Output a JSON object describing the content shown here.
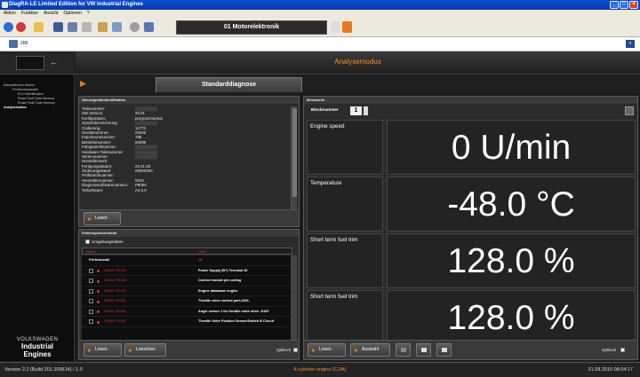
{
  "window": {
    "title": "DiagRA-LE Limited Edition for VW Industrial Engines"
  },
  "menu": [
    "Aktion",
    "Funktion",
    "Ansicht",
    "Optionen",
    "?"
  ],
  "toolbar": {
    "ecu_label": "01  Motorelektronik"
  },
  "toolbar2": {
    "count": "200"
  },
  "sidebar": {
    "tree": [
      {
        "label": "Automatischer Modus",
        "level": 1
      },
      {
        "label": "Funktionsauswahl",
        "level": 2
      },
      {
        "label": "ECU Identification",
        "level": 3
      },
      {
        "label": "Read Fault Code Memory",
        "level": 3
      },
      {
        "label": "Erase Fault Code Memory",
        "level": 3
      },
      {
        "label": "Analysemodus",
        "level": 1,
        "active": true
      }
    ],
    "brand_line1": "VOLKSWAGEN",
    "brand_line2": "Industrial",
    "brand_line3": "Engines"
  },
  "header": {
    "mode": "Analysemodus",
    "tab": "Standarddiagnose"
  },
  "ident": {
    "title": "Steuergeräteidentifikation",
    "rows": [
      {
        "key": "Teilenummer:",
        "value": "",
        "blur": true
      },
      {
        "key": "SW-Version:",
        "value": "XC21"
      },
      {
        "key": "Konfiguration:",
        "value": "programmierbar"
      },
      {
        "key": "Systembezeichnung:",
        "value": "",
        "blur": true
      },
      {
        "key": "Codierung:",
        "value": "11773"
      },
      {
        "key": "Gerätenummer:",
        "value": "00200"
      },
      {
        "key": "Importeursnummer:",
        "value": "786"
      },
      {
        "key": "Betriebsnummer:",
        "value": "00099"
      },
      {
        "key": "Fahrgestellnummer:",
        "value": "",
        "blur": true
      },
      {
        "key": "Hardware-Teilenummer:",
        "value": "",
        "blur": true
      },
      {
        "key": "Seriennummer:",
        "value": "",
        "blur": true
      },
      {
        "key": "Herstellerwerk:",
        "value": ""
      },
      {
        "key": "Fertigungsdatum:",
        "value": "23.01.03"
      },
      {
        "key": "Änderungsstand:",
        "value": "00000000"
      },
      {
        "key": "Prüfstandnummer:",
        "value": ""
      },
      {
        "key": "Herstellernummer:",
        "value": "0010"
      },
      {
        "key": "Diagnosesoftwarenummer:",
        "value": "P9000"
      },
      {
        "key": "Teilsoftware:",
        "value": "A4.6.5"
      }
    ],
    "read_button": "Lesen"
  },
  "faults": {
    "title": "Fehlerspeicherinhalt",
    "env_checkbox": "Umgebungsdaten",
    "col_name": "Name",
    "col_text": "Wert",
    "group": {
      "label": "Fehleranzahl",
      "value": "15"
    },
    "rows": [
      {
        "code": "16518 / P0134",
        "text": "Power Supply (B+) Terminal 30"
      },
      {
        "code": "16522 / P0138",
        "text": "Control module pin coding"
      },
      {
        "code": "16516 / P0132",
        "text": "Engine database/ engine"
      },
      {
        "code": "17662 / P1254",
        "text": "Throttle valve control part-2320-"
      },
      {
        "code": "17661 / P1253",
        "text": "Angle sensor 1 for throttle valve drive -G187"
      },
      {
        "code": "17659 / P1251",
        "text": "Throttle Valve Position Sensor/Switch B  Circuit"
      }
    ],
    "read_button": "Lesen",
    "clear_button": "Loeschen",
    "cyclic_label": "Zyklisch"
  },
  "meas": {
    "title": "Messwerte",
    "block_label": "Blocknummer",
    "block_value": "1",
    "rows": [
      {
        "label": "Engine speed",
        "value": "0 U/min"
      },
      {
        "label": "Temperature",
        "value": "-48.0 °C"
      },
      {
        "label": "Short term fuel trim",
        "value": "128.0 %"
      },
      {
        "label": "Short term fuel trim",
        "value": "128.0 %"
      }
    ],
    "read_button": "Lesen",
    "select_button": "Auswahl",
    "cyclic_label": "Zyklisch"
  },
  "status": {
    "version": "Version 2.2 (Build 201.100614) / 1.0",
    "engine": "4-cylinder engine (CJIA)",
    "datetime": "31.08.2010 08:04:17"
  },
  "colors": {
    "accent": "#ff8a1e",
    "fault_red": "#e0332c",
    "titlebar": "#0a4fd6"
  }
}
